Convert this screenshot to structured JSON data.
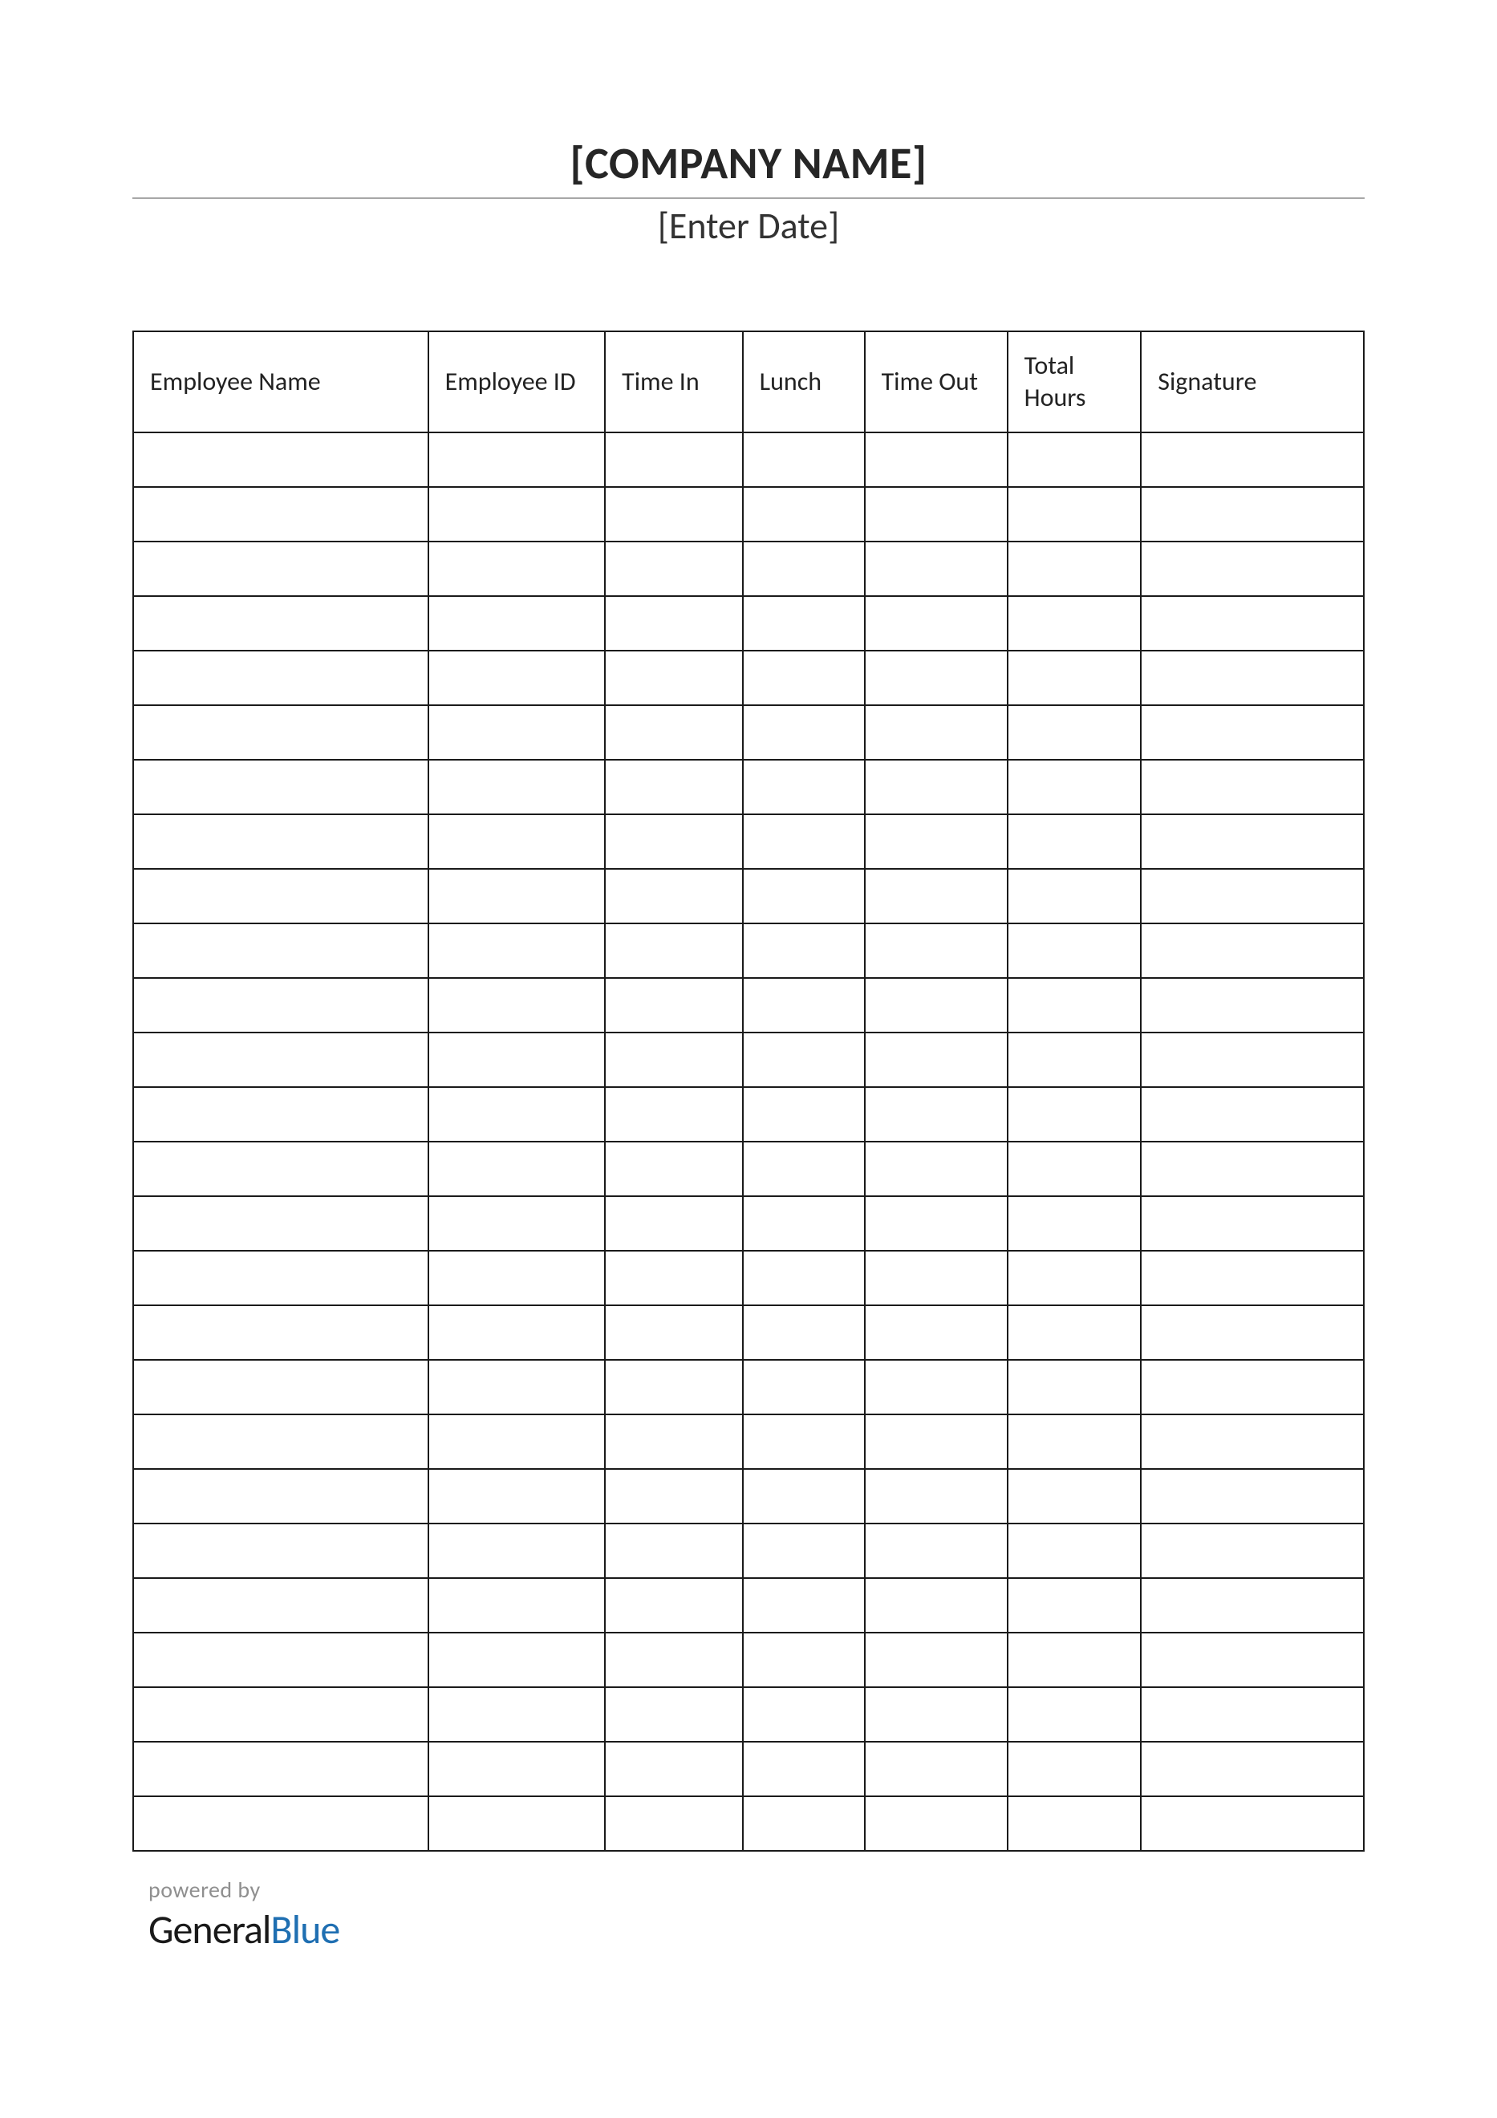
{
  "header": {
    "company_name": "[COMPANY NAME]",
    "date_placeholder": "[Enter Date]"
  },
  "table": {
    "columns": [
      "Employee Name",
      "Employee ID",
      "Time In",
      "Lunch",
      "Time Out",
      "Total Hours",
      "Signature"
    ],
    "row_count": 26
  },
  "footer": {
    "powered_by": "powered by",
    "brand_part1": "General",
    "brand_part2": "Blue"
  }
}
